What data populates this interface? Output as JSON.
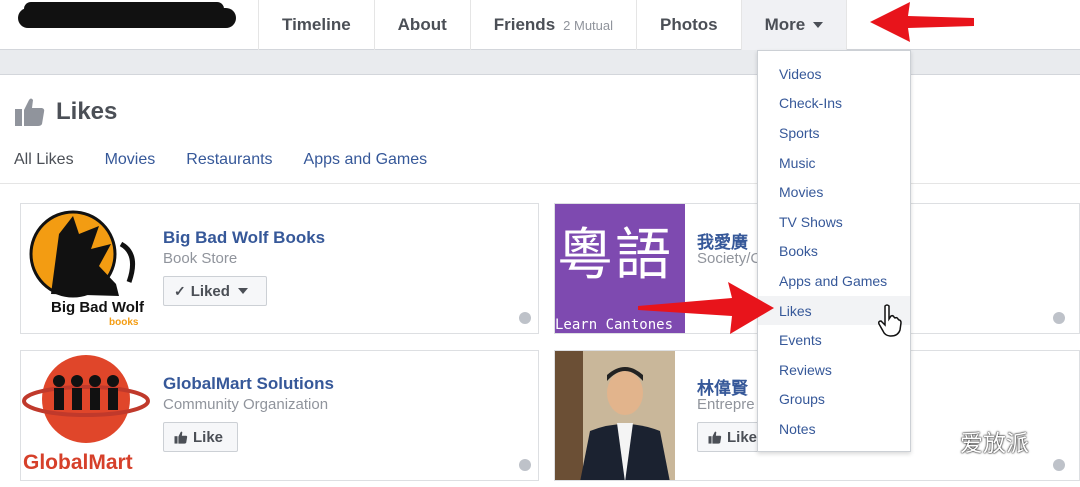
{
  "nav": {
    "timeline": "Timeline",
    "about": "About",
    "friends": "Friends",
    "friends_mutual": "2 Mutual",
    "photos": "Photos",
    "more": "More"
  },
  "likes": {
    "title": "Likes",
    "tabs": [
      "All Likes",
      "Movies",
      "Restaurants",
      "Apps and Games"
    ]
  },
  "cards": [
    {
      "title": "Big Bad Wolf Books",
      "subtitle": "Book Store",
      "button": "Liked",
      "logo_text": "Big Bad Wolf",
      "logo_sub": "books"
    },
    {
      "title": "我愛廣",
      "subtitle": "Society/C",
      "image_text": "粵語",
      "image_caption": "Learn Cantones"
    },
    {
      "title": "GlobalMart Solutions",
      "subtitle": "Community Organization",
      "button": "Like",
      "logo_text": "GlobalMart"
    },
    {
      "title": "林偉賢",
      "subtitle": "Entrepre",
      "button": "Like"
    }
  ],
  "dropdown": {
    "items": [
      "Videos",
      "Check-Ins",
      "Sports",
      "Music",
      "Movies",
      "TV Shows",
      "Books",
      "Apps and Games",
      "Likes",
      "Events",
      "Reviews",
      "Groups",
      "Notes"
    ],
    "hovered": "Likes"
  },
  "watermark": "爱放派",
  "colors": {
    "link": "#365899",
    "arrow": "#e8141b",
    "panel_bg": "#e9ebee"
  }
}
